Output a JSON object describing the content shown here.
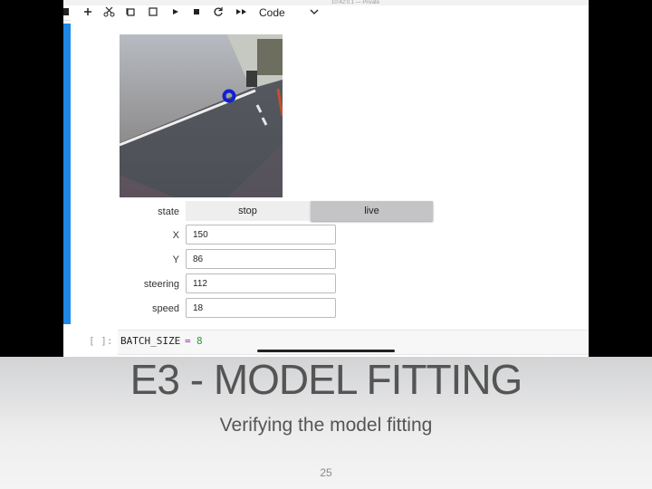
{
  "browser": {
    "status_text": "10:42:0.1 — Private"
  },
  "toolbar": {
    "cell_type": "Code",
    "icons": [
      "save-icon",
      "add-icon",
      "cut-icon",
      "copy-icon",
      "paste-icon",
      "run-icon",
      "stop-icon",
      "restart-icon",
      "fast-forward-icon",
      "chevron-down-icon"
    ]
  },
  "widget": {
    "state_label": "state",
    "stop_label": "stop",
    "live_label": "live",
    "x_label": "X",
    "x_value": "150",
    "y_label": "Y",
    "y_value": "86",
    "steering_label": "steering",
    "steering_value": "112",
    "speed_label": "speed",
    "speed_value": "18"
  },
  "code": {
    "prompt": "[ ]:",
    "var": "BATCH_SIZE",
    "op": "=",
    "num": "8"
  },
  "slide": {
    "title": "E3 - MODEL FITTING",
    "subtitle": "Verifying the model fitting",
    "page_number": "25"
  },
  "colors": {
    "cell_marker": "#1e88e5",
    "target_circle": "#1020d0",
    "live_active_bg": "#c4c4c6",
    "number_green": "#2e9a2e",
    "operator_purple": "#9c27b0"
  }
}
